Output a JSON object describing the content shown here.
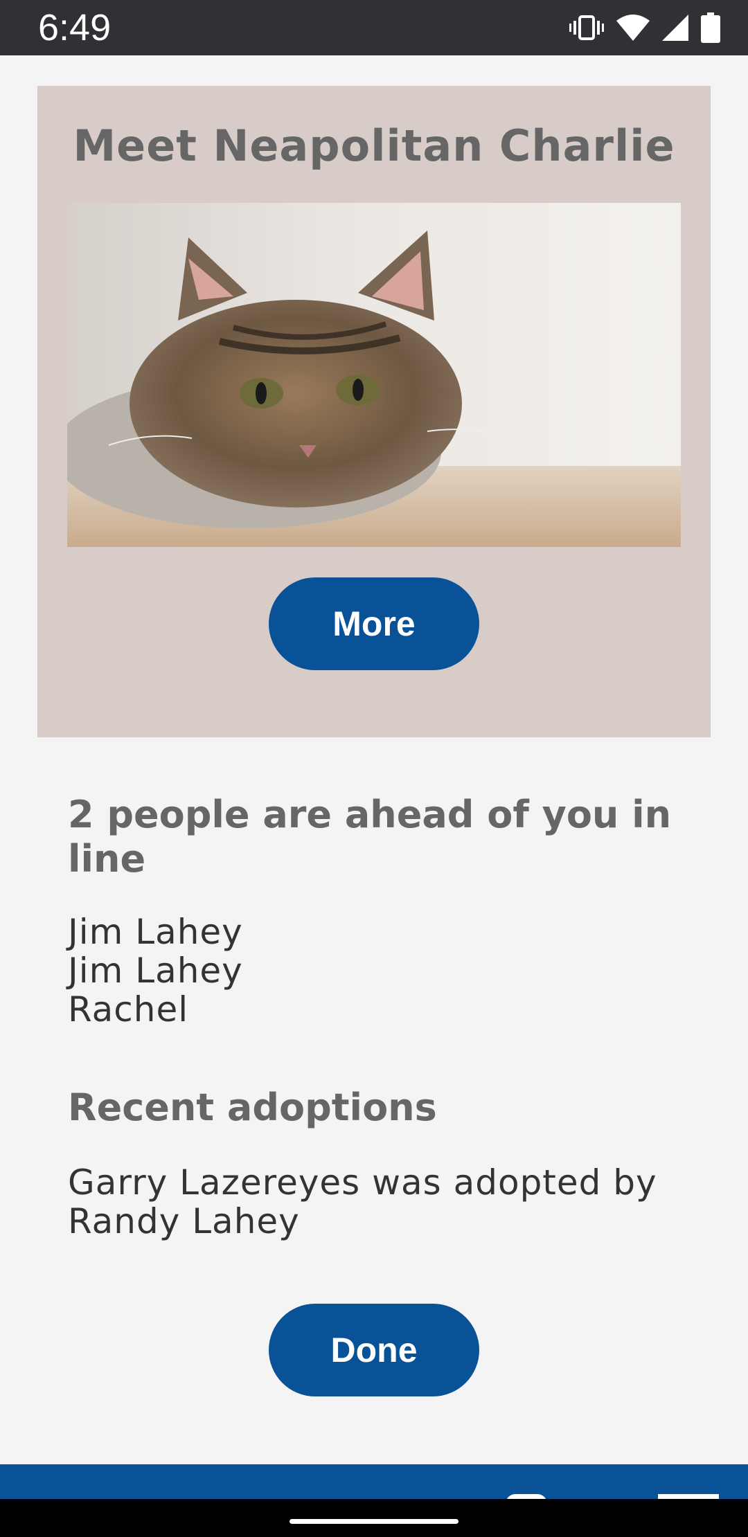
{
  "status_bar": {
    "time": "6:49",
    "icons": [
      "vibrate-icon",
      "wifi-icon",
      "signal-icon",
      "battery-icon"
    ]
  },
  "card": {
    "title": "Meet Neapolitan Charlie",
    "more_label": "More"
  },
  "queue": {
    "heading": "2 people are ahead of you in line",
    "people": [
      "Jim Lahey",
      "Jim Lahey",
      "Rachel"
    ]
  },
  "adoptions": {
    "heading": "Recent adoptions",
    "text": "Garry Lazereyes was adopted by Randy Lahey"
  },
  "done_label": "Done",
  "colors": {
    "status_bar": "#303134",
    "background": "#f4f4f4",
    "card": "#d8ccc9",
    "accent": "#0a5297",
    "heading": "#666666"
  }
}
